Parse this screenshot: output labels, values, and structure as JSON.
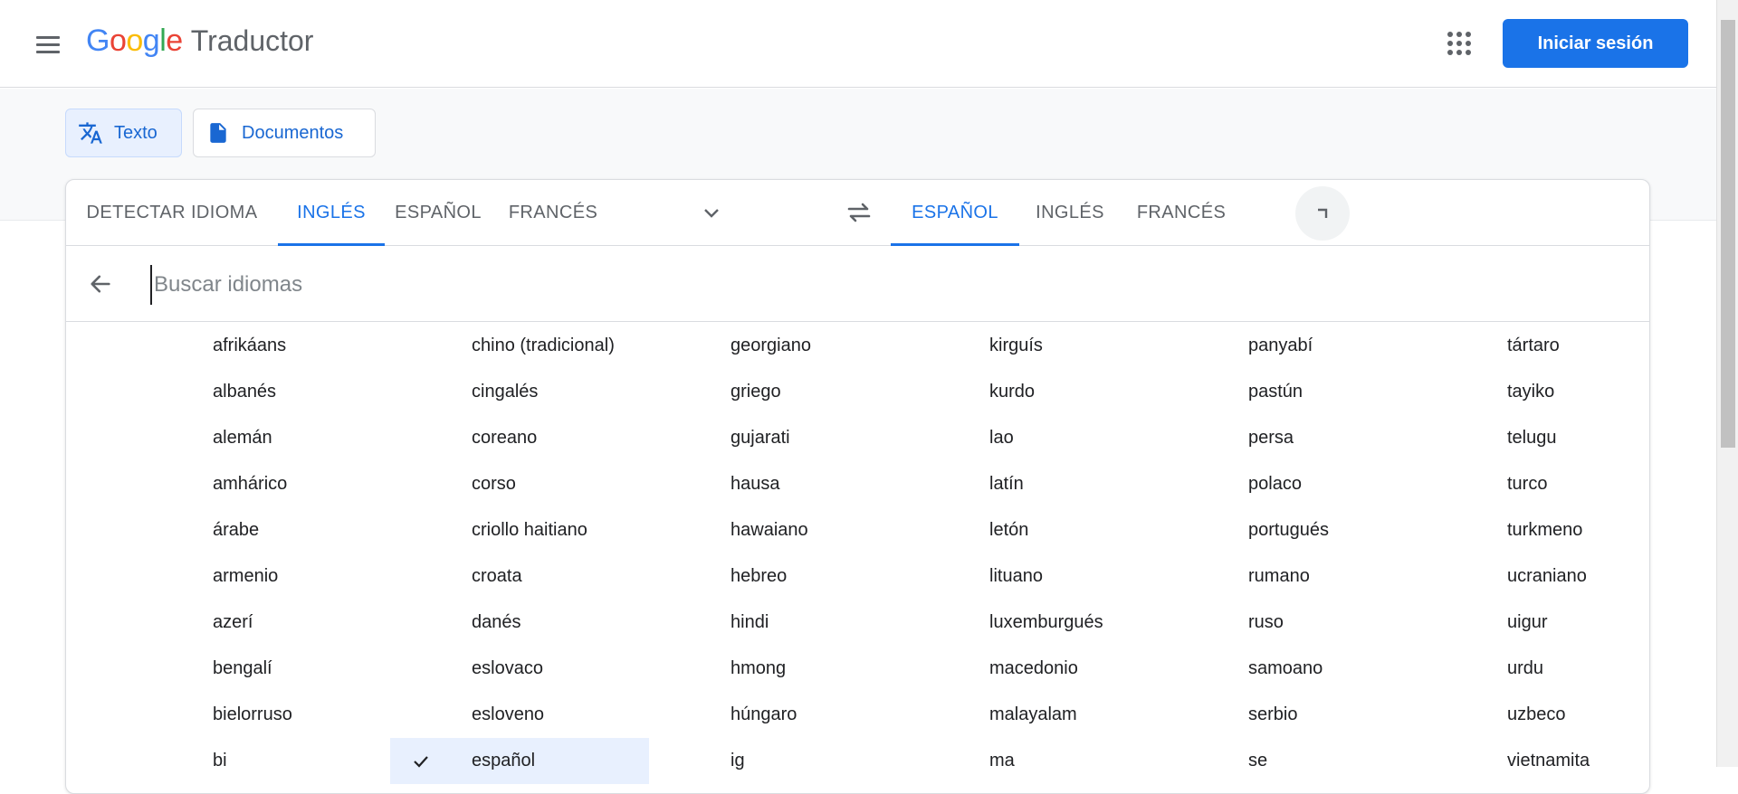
{
  "header": {
    "logo_letters": [
      {
        "ch": "G",
        "color": "#4285F4"
      },
      {
        "ch": "o",
        "color": "#EA4335"
      },
      {
        "ch": "o",
        "color": "#FBBC05"
      },
      {
        "ch": "g",
        "color": "#4285F4"
      },
      {
        "ch": "l",
        "color": "#34A853"
      },
      {
        "ch": "e",
        "color": "#EA4335"
      }
    ],
    "product": "Traductor",
    "signin_label": "Iniciar sesión"
  },
  "modes": {
    "text_label": "Texto",
    "docs_label": "Documentos"
  },
  "source_tabs": [
    "DETECTAR IDIOMA",
    "INGLÉS",
    "ESPAÑOL",
    "FRANCÉS"
  ],
  "source_active": 1,
  "target_tabs": [
    "ESPAÑOL",
    "INGLÉS",
    "FRANCÉS"
  ],
  "target_active": 0,
  "search": {
    "placeholder": "Buscar idiomas",
    "value": ""
  },
  "languages": [
    [
      "afrikáans",
      "albanés",
      "alemán",
      "amhárico",
      "árabe",
      "armenio",
      "azerí",
      "bengalí",
      "bielorruso",
      "bi"
    ],
    [
      "chino (tradicional)",
      "cingalés",
      "coreano",
      "corso",
      "criollo haitiano",
      "croata",
      "danés",
      "eslovaco",
      "esloveno",
      "español"
    ],
    [
      "georgiano",
      "griego",
      "gujarati",
      "hausa",
      "hawaiano",
      "hebreo",
      "hindi",
      "hmong",
      "húngaro",
      "ig"
    ],
    [
      "kirguís",
      "kurdo",
      "lao",
      "latín",
      "letón",
      "lituano",
      "luxemburgués",
      "macedonio",
      "malayalam",
      "ma"
    ],
    [
      "panyabí",
      "pastún",
      "persa",
      "polaco",
      "portugués",
      "rumano",
      "ruso",
      "samoano",
      "serbio",
      "se"
    ],
    [
      "tártaro",
      "tayiko",
      "telugu",
      "turco",
      "turkmeno",
      "ucraniano",
      "uigur",
      "urdu",
      "uzbeco",
      "vietnamita"
    ]
  ],
  "selected_language": {
    "col": 1,
    "row": 9
  },
  "colors": {
    "accent": "#1a73e8",
    "selected_bg": "#e8f0fe"
  }
}
